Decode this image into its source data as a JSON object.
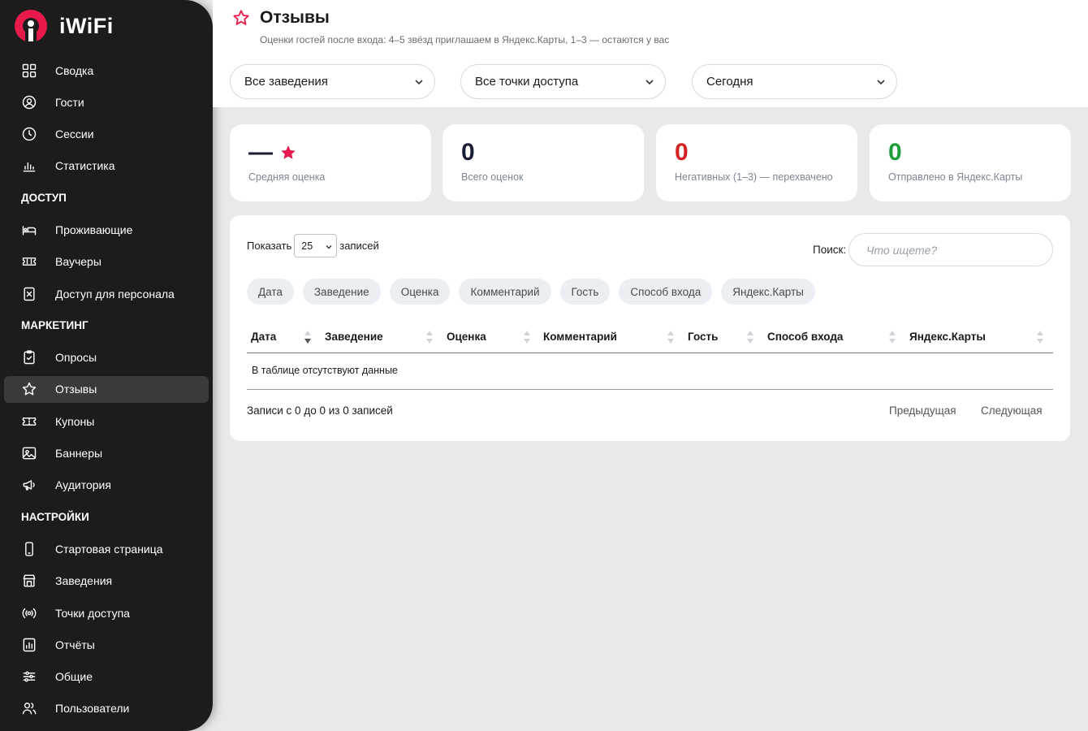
{
  "app": {
    "name": "iWiFi",
    "brand_color": "#e8194b"
  },
  "sidebar": {
    "items": [
      {
        "type": "item",
        "label": "Сводка",
        "icon": "dashboard-grid-icon"
      },
      {
        "type": "item",
        "label": "Гости",
        "icon": "user-circle-icon"
      },
      {
        "type": "item",
        "label": "Сессии",
        "icon": "clock-icon"
      },
      {
        "type": "item",
        "label": "Статистика",
        "icon": "bar-chart-icon"
      },
      {
        "type": "section",
        "label": "ДОСТУП"
      },
      {
        "type": "item",
        "label": "Проживающие",
        "icon": "bed-icon"
      },
      {
        "type": "item",
        "label": "Ваучеры",
        "icon": "ticket-icon"
      },
      {
        "type": "item",
        "label": "Доступ для персонала",
        "icon": "staff-badge-icon"
      },
      {
        "type": "section",
        "label": "МАРКЕТИНГ"
      },
      {
        "type": "item",
        "label": "Опросы",
        "icon": "clipboard-icon"
      },
      {
        "type": "item",
        "label": "Отзывы",
        "icon": "star-icon",
        "active": true
      },
      {
        "type": "item",
        "label": "Купоны",
        "icon": "coupon-icon"
      },
      {
        "type": "item",
        "label": "Баннеры",
        "icon": "image-icon"
      },
      {
        "type": "item",
        "label": "Аудитория",
        "icon": "megaphone-icon"
      },
      {
        "type": "section",
        "label": "НАСТРОЙКИ"
      },
      {
        "type": "item",
        "label": "Стартовая страница",
        "icon": "phone-icon"
      },
      {
        "type": "item",
        "label": "Заведения",
        "icon": "store-icon"
      },
      {
        "type": "item",
        "label": "Точки доступа",
        "icon": "broadcast-icon"
      },
      {
        "type": "item",
        "label": "Отчёты",
        "icon": "report-icon"
      },
      {
        "type": "item",
        "label": "Общие",
        "icon": "sliders-icon"
      },
      {
        "type": "item",
        "label": "Пользователи",
        "icon": "users-icon"
      }
    ]
  },
  "header": {
    "title": "Отзывы",
    "subtitle": "Оценки гостей после входа: 4–5 звёзд приглашаем в Яндекс.Карты, 1–3 — остаются у вас",
    "filters": {
      "venue": "Все заведения",
      "access_point": "Все точки доступа",
      "period": "Сегодня"
    }
  },
  "stats": [
    {
      "value": "—",
      "caption": "Средняя оценка",
      "color": "#1a1f36"
    },
    {
      "value": "0",
      "caption": "Всего оценок",
      "color": "#1a1f36"
    },
    {
      "value": "0",
      "caption": "Негативных (1–3) — перехвачено",
      "color": "#d32222"
    },
    {
      "value": "0",
      "caption": "Отправлено в Яндекс.Карты",
      "color": "#1f9e3a"
    }
  ],
  "table": {
    "show_label": "Показать",
    "page_size": "25",
    "records_label": "записей",
    "search_label": "Поиск:",
    "search_placeholder": "Что ищете?",
    "column_chips": [
      "Дата",
      "Заведение",
      "Оценка",
      "Комментарий",
      "Гость",
      "Способ входа",
      "Яндекс.Карты"
    ],
    "columns": [
      "Дата",
      "Заведение",
      "Оценка",
      "Комментарий",
      "Гость",
      "Способ входа",
      "Яндекс.Карты"
    ],
    "empty_text": "В таблице отсутствуют данные",
    "info_text": "Записи с 0 до 0 из 0 записей",
    "prev_label": "Предыдущая",
    "next_label": "Следующая"
  }
}
